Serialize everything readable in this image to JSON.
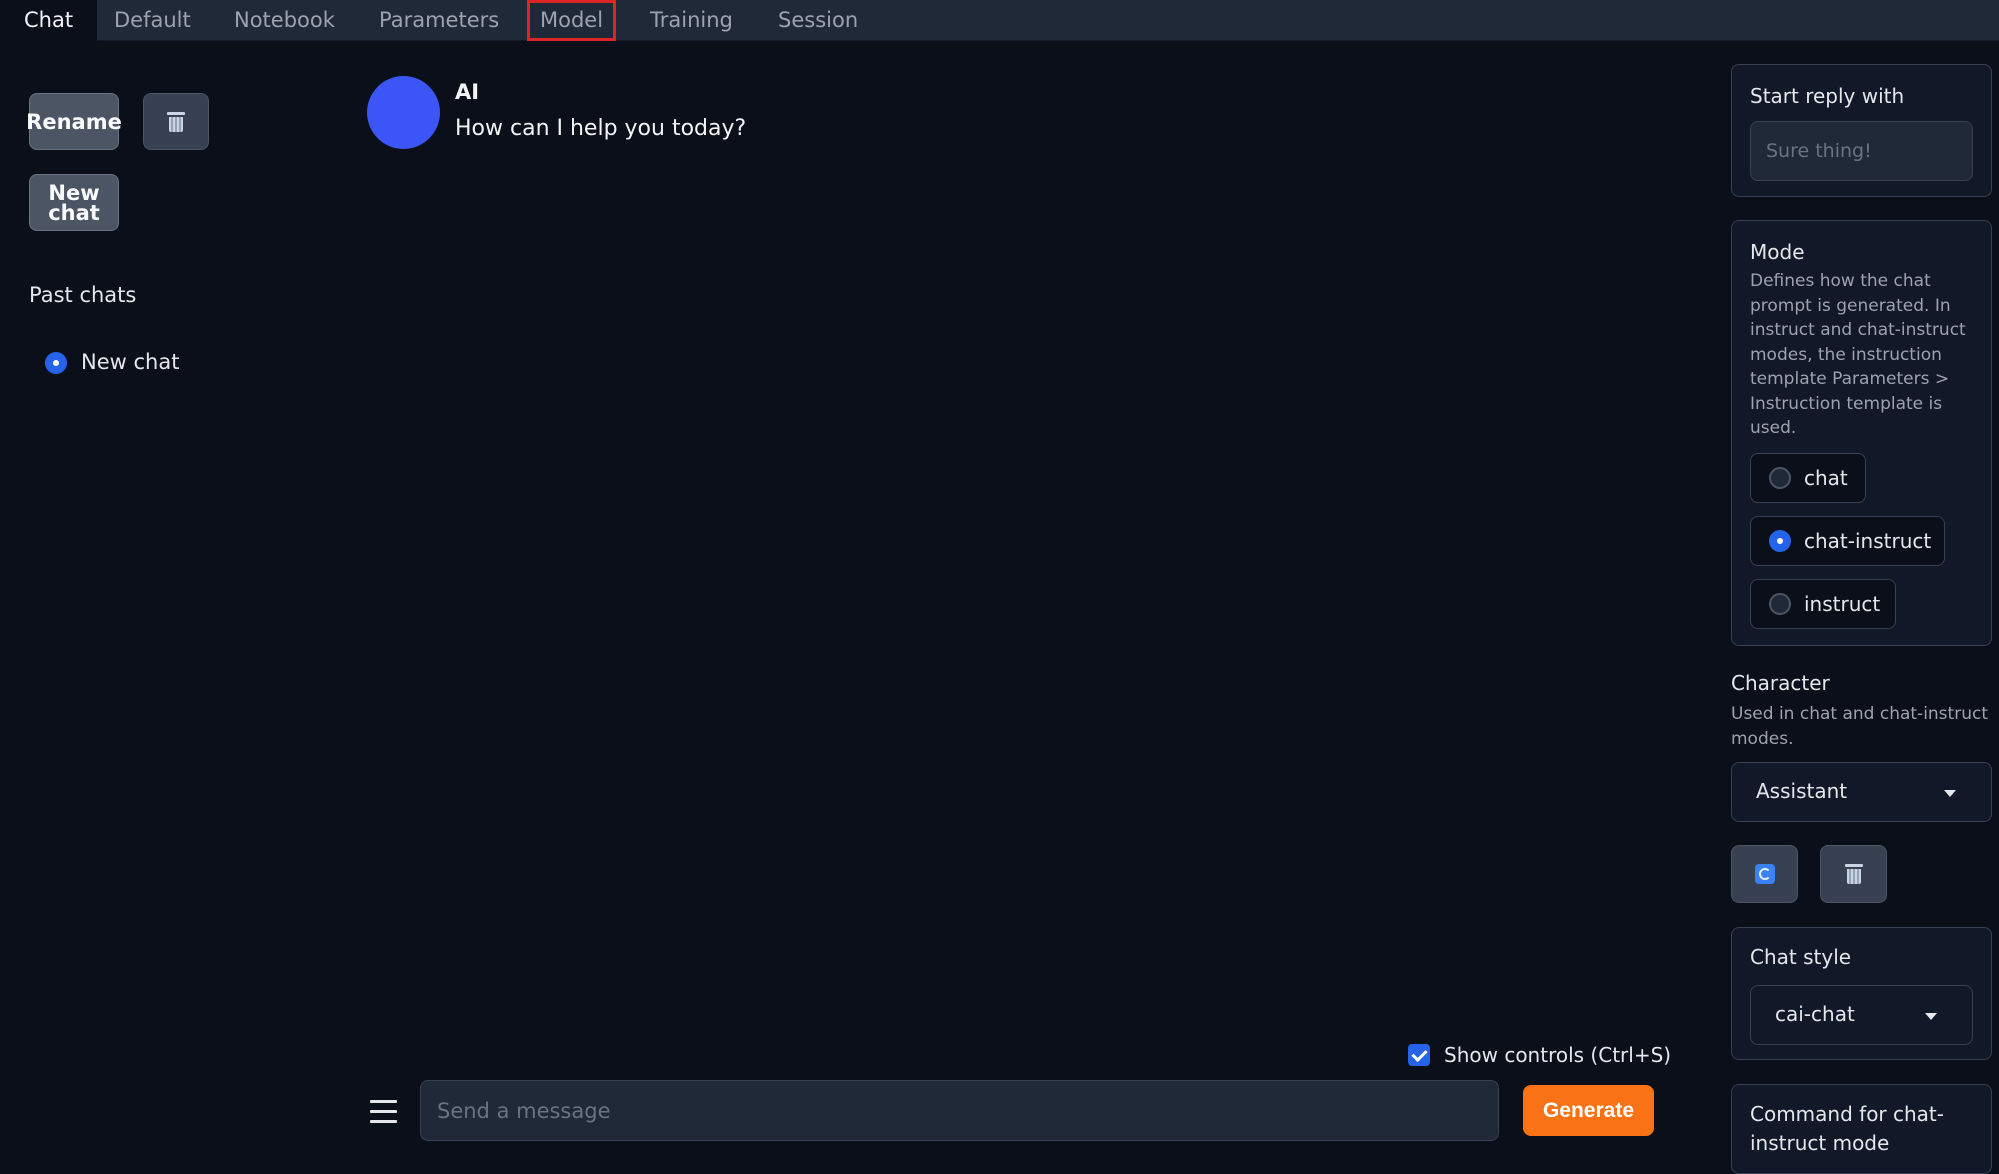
{
  "tabs": [
    "Chat",
    "Default",
    "Notebook",
    "Parameters",
    "Model",
    "Training",
    "Session"
  ],
  "left": {
    "rename_label": "Rename",
    "new_chat_label": "New\nchat",
    "past_chats_label": "Past chats",
    "chats": [
      {
        "label": "New chat",
        "selected": true
      }
    ]
  },
  "chat": {
    "author": "AI",
    "message": "How can I help you today?",
    "avatar_color": "#3b55f6",
    "show_controls_label": "Show controls (Ctrl+S)",
    "input_placeholder": "Send a message",
    "generate_label": "Generate",
    "generate_color": "#f97316"
  },
  "right": {
    "start_reply": {
      "title": "Start reply with",
      "placeholder": "Sure thing!"
    },
    "mode": {
      "title": "Mode",
      "description": "Defines how the chat prompt is generated. In instruct and chat-instruct modes, the instruction template Parameters > Instruction template is used.",
      "options": [
        "chat",
        "chat-instruct",
        "instruct"
      ],
      "selected": "chat-instruct"
    },
    "character": {
      "title": "Character",
      "description": "Used in chat and chat-instruct modes.",
      "value": "Assistant"
    },
    "chat_style": {
      "title": "Chat style",
      "value": "cai-chat"
    },
    "command": {
      "title": "Command for chat-instruct mode"
    }
  },
  "icons": {
    "delete": "trash-icon",
    "refresh": "refresh-icon",
    "menu": "hamburger-menu-icon",
    "dropdown": "caret-down-icon"
  }
}
